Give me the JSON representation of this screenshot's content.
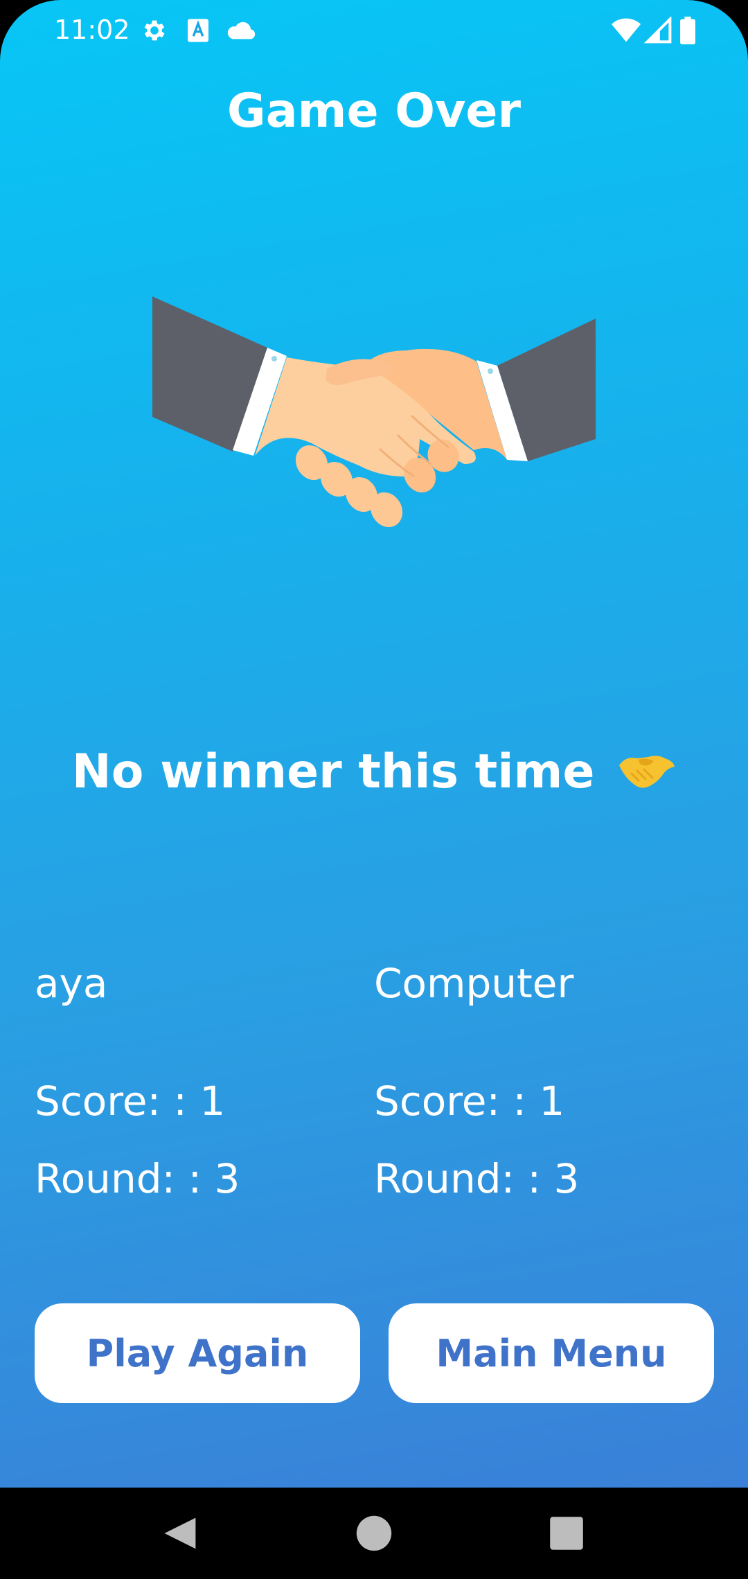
{
  "status_bar": {
    "time": "11:02",
    "left_icons": [
      "gear-icon",
      "font-a-icon",
      "cloud-icon"
    ],
    "right_icons": [
      "wifi-icon",
      "cellular-signal-icon",
      "battery-icon"
    ]
  },
  "header": {
    "title": "Game Over"
  },
  "illustration": {
    "icon": "handshake-illustration"
  },
  "result": {
    "message": "No winner this time",
    "emoji_icon": "handshake-emoji-icon"
  },
  "players": [
    {
      "name": "aya",
      "score_text": "Score: : 1",
      "round_text": "Round: : 3"
    },
    {
      "name": "Computer",
      "score_text": "Score: : 1",
      "round_text": "Round: : 3"
    }
  ],
  "actions": {
    "play_again_label": "Play Again",
    "main_menu_label": "Main Menu"
  },
  "nav_bar": {
    "buttons": [
      "back-icon",
      "home-icon",
      "recents-icon"
    ]
  },
  "colors": {
    "gradient_top": "#07c6f6",
    "gradient_bottom": "#3a80d8",
    "button_text": "#3f72c9",
    "button_bg": "#ffffff"
  }
}
